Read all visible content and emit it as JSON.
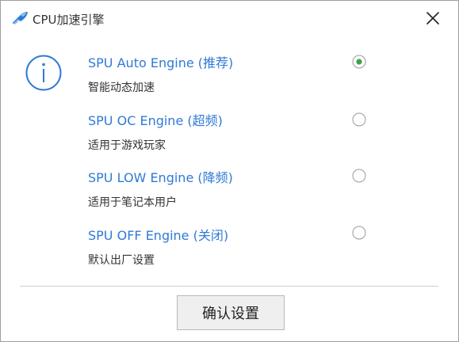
{
  "window": {
    "title": "CPU加速引擎",
    "app_icon": "rocket-icon",
    "close_icon": "close-icon"
  },
  "info_icon": "info-icon",
  "options": [
    {
      "title": "SPU Auto Engine (推荐)",
      "description": "智能动态加速",
      "selected": true
    },
    {
      "title": "SPU OC Engine (超频)",
      "description": "适用于游戏玩家",
      "selected": false
    },
    {
      "title": "SPU LOW Engine (降频)",
      "description": "适用于笔记本用户",
      "selected": false
    },
    {
      "title": "SPU OFF Engine (关闭)",
      "description": "默认出厂设置",
      "selected": false
    }
  ],
  "confirm_label": "确认设置",
  "colors": {
    "accent": "#2f7ad6",
    "radio_selected": "#3aa24a",
    "text": "#333333"
  }
}
